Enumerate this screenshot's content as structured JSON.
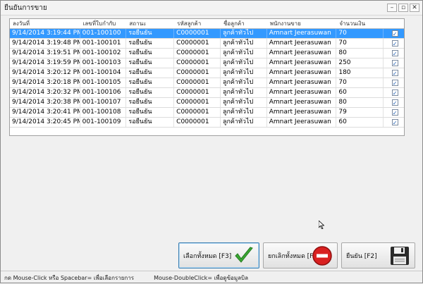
{
  "window": {
    "title": "ยืนยันการขาย",
    "minimize": "–",
    "restore": "▫",
    "close": "✕"
  },
  "table": {
    "columns": [
      "ลงวันที่",
      "เลขที่ใบกำกับ",
      "สถานะ",
      "รหัสลูกค้า",
      "ชื่อลูกค้า",
      "พนักงานขาย",
      "จำนวนเงิน",
      ""
    ],
    "rows": [
      {
        "date": "9/14/2014 3:19:44 PM",
        "invoice": "001-100100",
        "status": "รอยืนยัน",
        "customer_code": "C0000001",
        "customer_name": "ลูกค้าทั่วไป",
        "salesperson": "Amnart Jeerasuwan",
        "amount": "70",
        "checked": true,
        "selected": true
      },
      {
        "date": "9/14/2014 3:19:48 PM",
        "invoice": "001-100101",
        "status": "รอยืนยัน",
        "customer_code": "C0000001",
        "customer_name": "ลูกค้าทั่วไป",
        "salesperson": "Amnart Jeerasuwan",
        "amount": "70",
        "checked": true,
        "selected": false
      },
      {
        "date": "9/14/2014 3:19:51 PM",
        "invoice": "001-100102",
        "status": "รอยืนยัน",
        "customer_code": "C0000001",
        "customer_name": "ลูกค้าทั่วไป",
        "salesperson": "Amnart Jeerasuwan",
        "amount": "80",
        "checked": true,
        "selected": false
      },
      {
        "date": "9/14/2014 3:19:59 PM",
        "invoice": "001-100103",
        "status": "รอยืนยัน",
        "customer_code": "C0000001",
        "customer_name": "ลูกค้าทั่วไป",
        "salesperson": "Amnart Jeerasuwan",
        "amount": "250",
        "checked": true,
        "selected": false
      },
      {
        "date": "9/14/2014 3:20:12 PM",
        "invoice": "001-100104",
        "status": "รอยืนยัน",
        "customer_code": "C0000001",
        "customer_name": "ลูกค้าทั่วไป",
        "salesperson": "Amnart Jeerasuwan",
        "amount": "180",
        "checked": true,
        "selected": false
      },
      {
        "date": "9/14/2014 3:20:18 PM",
        "invoice": "001-100105",
        "status": "รอยืนยัน",
        "customer_code": "C0000001",
        "customer_name": "ลูกค้าทั่วไป",
        "salesperson": "Amnart Jeerasuwan",
        "amount": "70",
        "checked": true,
        "selected": false
      },
      {
        "date": "9/14/2014 3:20:32 PM",
        "invoice": "001-100106",
        "status": "รอยืนยัน",
        "customer_code": "C0000001",
        "customer_name": "ลูกค้าทั่วไป",
        "salesperson": "Amnart Jeerasuwan",
        "amount": "60",
        "checked": true,
        "selected": false
      },
      {
        "date": "9/14/2014 3:20:38 PM",
        "invoice": "001-100107",
        "status": "รอยืนยัน",
        "customer_code": "C0000001",
        "customer_name": "ลูกค้าทั่วไป",
        "salesperson": "Amnart Jeerasuwan",
        "amount": "80",
        "checked": true,
        "selected": false
      },
      {
        "date": "9/14/2014 3:20:41 PM",
        "invoice": "001-100108",
        "status": "รอยืนยัน",
        "customer_code": "C0000001",
        "customer_name": "ลูกค้าทั่วไป",
        "salesperson": "Amnart Jeerasuwan",
        "amount": "79",
        "checked": true,
        "selected": false
      },
      {
        "date": "9/14/2014 3:20:45 PM",
        "invoice": "001-100109",
        "status": "รอยืนยัน",
        "customer_code": "C0000001",
        "customer_name": "ลูกค้าทั่วไป",
        "salesperson": "Amnart Jeerasuwan",
        "amount": "60",
        "checked": true,
        "selected": false
      }
    ],
    "check_mark": "✓",
    "selection_color": "#3399ff"
  },
  "buttons": {
    "select_all": {
      "label": "เลือกทั้งหมด [F3]",
      "icon": "green-checkmark-icon"
    },
    "cancel_all": {
      "label": "ยกเลิกทั้งหมด [F4]",
      "icon": "red-minus-icon"
    },
    "confirm": {
      "label": "ยืนยัน [F2]",
      "icon": "save-disk-icon"
    }
  },
  "status_bar": {
    "hint_click": "กด Mouse-Click หรือ Spacebar= เพื่อเลือกรายการ",
    "hint_double": "Mouse-DoubleClick= เพื่อดูข้อมูลบิล"
  }
}
